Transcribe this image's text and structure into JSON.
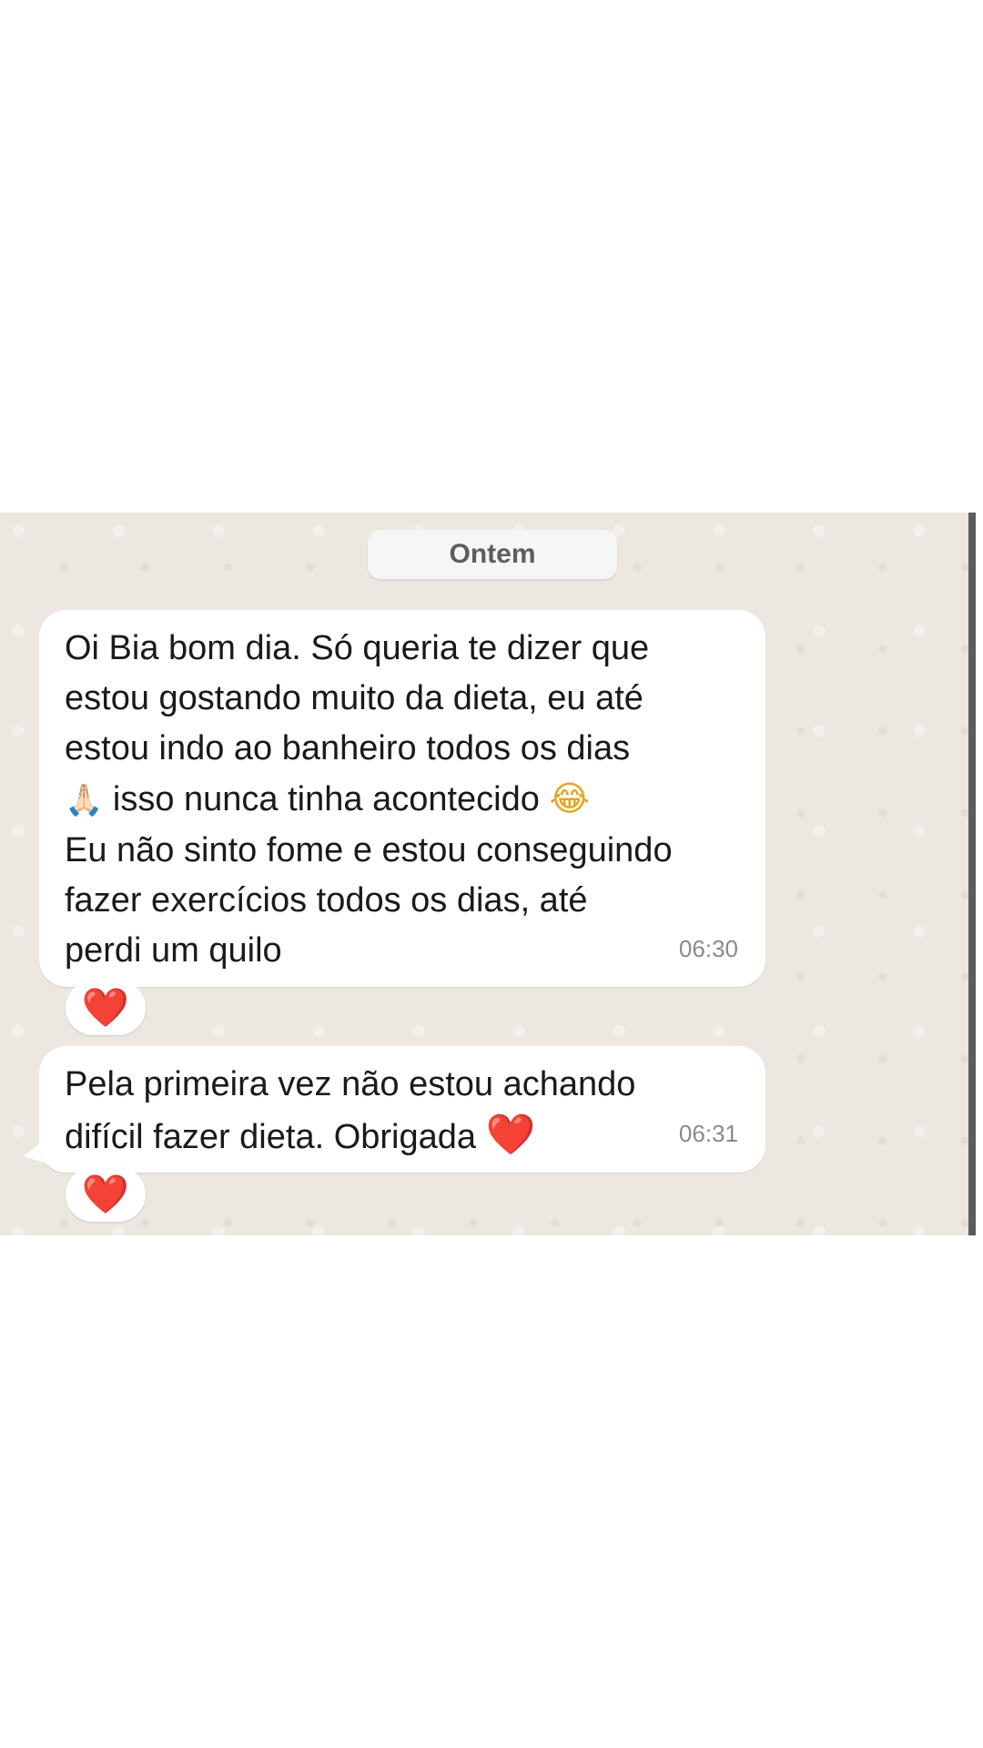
{
  "chat": {
    "date_label": "Ontem",
    "messages": [
      {
        "lines": [
          "Oi Bia bom dia. Só queria te dizer que",
          "estou gostando muito da dieta, eu até",
          "estou indo ao banheiro todos os dias"
        ],
        "line4_emoji": "🙏🏻",
        "line4_text": " isso nunca tinha acontecido ",
        "line4_end_emoji": "😂",
        "lines_after": [
          "Eu não sinto fome e estou conseguindo",
          "fazer exercícios todos os dias, até",
          "perdi um quilo"
        ],
        "time": "06:30",
        "reaction": "❤️"
      },
      {
        "lines": [
          "Pela primeira vez não estou achando"
        ],
        "line2_text": "difícil fazer dieta. Obrigada ",
        "line2_emoji": "❤️",
        "time": "06:31",
        "reaction": "❤️"
      }
    ]
  },
  "colors": {
    "chat_background": "#ece7e1",
    "bubble_background": "#ffffff",
    "date_pill_background": "#f6f6f6",
    "timestamp_text": "#8a8a8a",
    "heart": "#e32b3a"
  },
  "icons": {
    "reaction_icon": "red-heart-icon",
    "emoji_icons": [
      "folded-hands-icon",
      "face-with-tears-of-joy-icon",
      "red-heart-icon"
    ]
  }
}
